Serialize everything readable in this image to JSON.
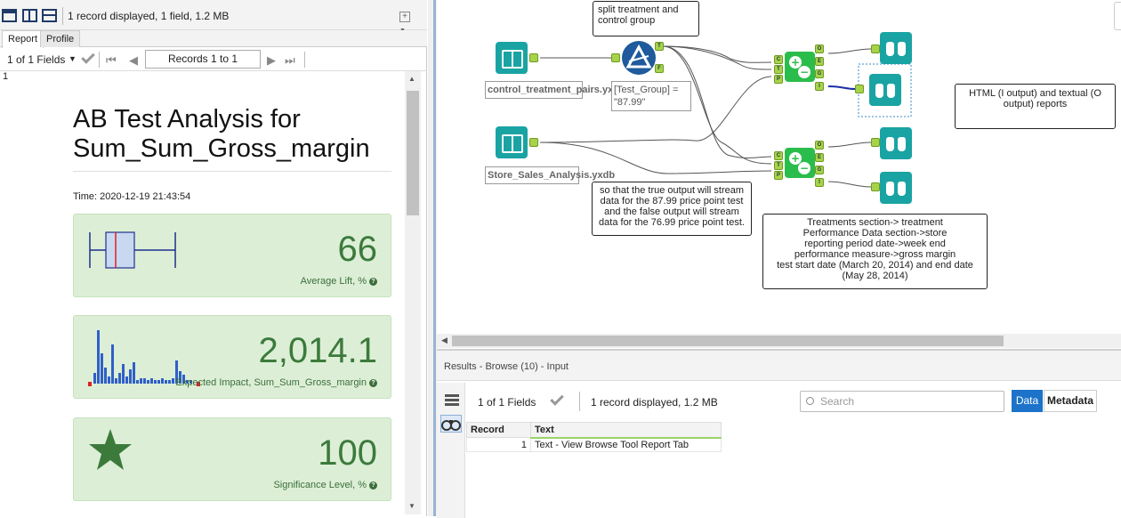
{
  "browse": {
    "status": "1 record displayed, 1 field, 1.2 MB",
    "tabs": [
      "Report",
      "Profile"
    ],
    "fields_label": "1 of 1 Fields",
    "records_label": "Records 1 to 1",
    "row_number": "1"
  },
  "report": {
    "title": "AB Test Analysis for Sum_Sum_Gross_margin",
    "time": "Time: 2020-12-19 21:43:54",
    "cards": [
      {
        "value": "66",
        "label": "Average Lift, %",
        "icon": "boxplot-icon"
      },
      {
        "value": "2,014.1",
        "label": "Expected Impact, Sum_Sum_Gross_margin",
        "icon": "histogram-icon"
      },
      {
        "value": "100",
        "label": "Significance Level, %",
        "icon": "star-icon"
      }
    ]
  },
  "canvas": {
    "notes": {
      "split": "split treatment and control group",
      "stream": "so that the true output will stream data for the 87.99 price point test and the false output will stream data for the 76.99 price point test.",
      "html": "HTML (I output) and textual (O output) reports",
      "treatments": "Treatments section-> treatment\nPerformance Data section->store\nreporting period date->week end\nperformance measure->gross margin\ntest start date (March 20, 2014) and end date\n(May 28, 2014)"
    },
    "tools": {
      "input1": "control_treatment_pairs.yxdb",
      "input2": "Store_Sales_Analysis.yxdb",
      "filter": "[Test_Group] = \"87.99\""
    },
    "anchors": {
      "filter_true": "T",
      "filter_false": "F",
      "ab_in": [
        "C",
        "T",
        "P"
      ],
      "ab_out": [
        "O",
        "E",
        "G",
        "I"
      ]
    }
  },
  "results": {
    "title": "Results - Browse (10) - Input",
    "fields_label": "1 of 1 Fields",
    "records_label": "1 record displayed, 1.2 MB",
    "search_placeholder": "Search",
    "data_btn": "Data",
    "meta_btn": "Metadata",
    "columns": [
      "Record",
      "Text"
    ],
    "rows": [
      {
        "record": "1",
        "text": "Text - View Browse Tool Report Tab"
      }
    ]
  },
  "colors": {
    "accent": "#1c73c9",
    "card_bg": "#dcefd6",
    "value_green": "#3c7a3c",
    "tool_teal": "#1aa3a3"
  }
}
